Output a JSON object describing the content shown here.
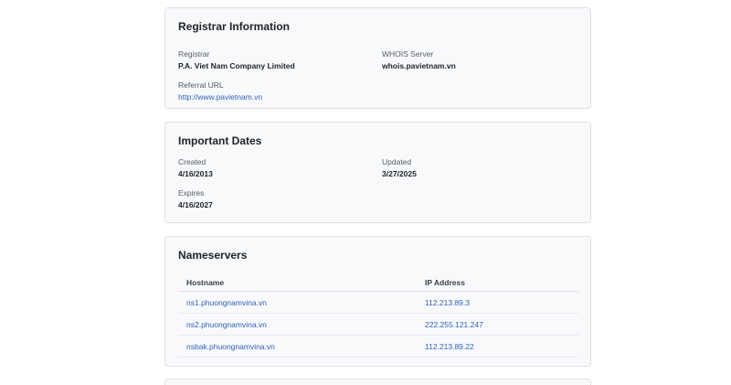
{
  "registrar": {
    "title": "Registrar Information",
    "registrar_label": "Registrar",
    "registrar_value": "P.A. Viet Nam Company Limited",
    "whois_label": "WHOIS Server",
    "whois_value": "whois.pavietnam.vn",
    "referral_label": "Referral URL",
    "referral_value": "http://www.pavietnam.vn"
  },
  "dates": {
    "title": "Important Dates",
    "created_label": "Created",
    "created_value": "4/16/2013",
    "updated_label": "Updated",
    "updated_value": "3/27/2025",
    "expires_label": "Expires",
    "expires_value": "4/16/2027"
  },
  "nameservers": {
    "title": "Nameservers",
    "columns": [
      "Hostname",
      "IP Address"
    ],
    "rows": [
      {
        "hostname": "ns1.phuongnamvina.vn",
        "ip": "112.213.89.3"
      },
      {
        "hostname": "ns2.phuongnamvina.vn",
        "ip": "222.255.121.247"
      },
      {
        "hostname": "nsbak.phuongnamvina.vn",
        "ip": "112.213.89.22"
      }
    ]
  },
  "colors": {
    "link": "#2f62b8",
    "card_bg": "#f8f9fb",
    "card_border": "#dfe2e6"
  }
}
